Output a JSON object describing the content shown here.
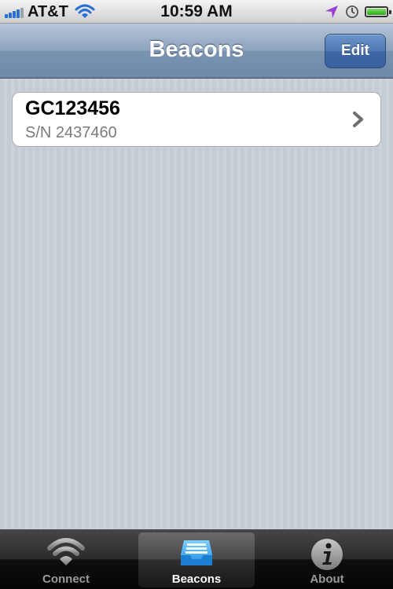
{
  "status_bar": {
    "carrier": "AT&T",
    "time": "10:59 AM"
  },
  "nav": {
    "title": "Beacons",
    "edit_label": "Edit"
  },
  "list": {
    "items": [
      {
        "title": "GC123456",
        "subtitle": "S/N 2437460"
      }
    ]
  },
  "tabs": [
    {
      "label": "Connect",
      "icon": "wifi-icon",
      "selected": false
    },
    {
      "label": "Beacons",
      "icon": "inbox-icon",
      "selected": true
    },
    {
      "label": "About",
      "icon": "info-icon",
      "selected": false
    }
  ],
  "colors": {
    "nav_accent": "#4f78b3",
    "signal_blue": "#2a6fd6",
    "location_arrow": "#9b3fd6",
    "battery_green": "#2fa51a"
  }
}
